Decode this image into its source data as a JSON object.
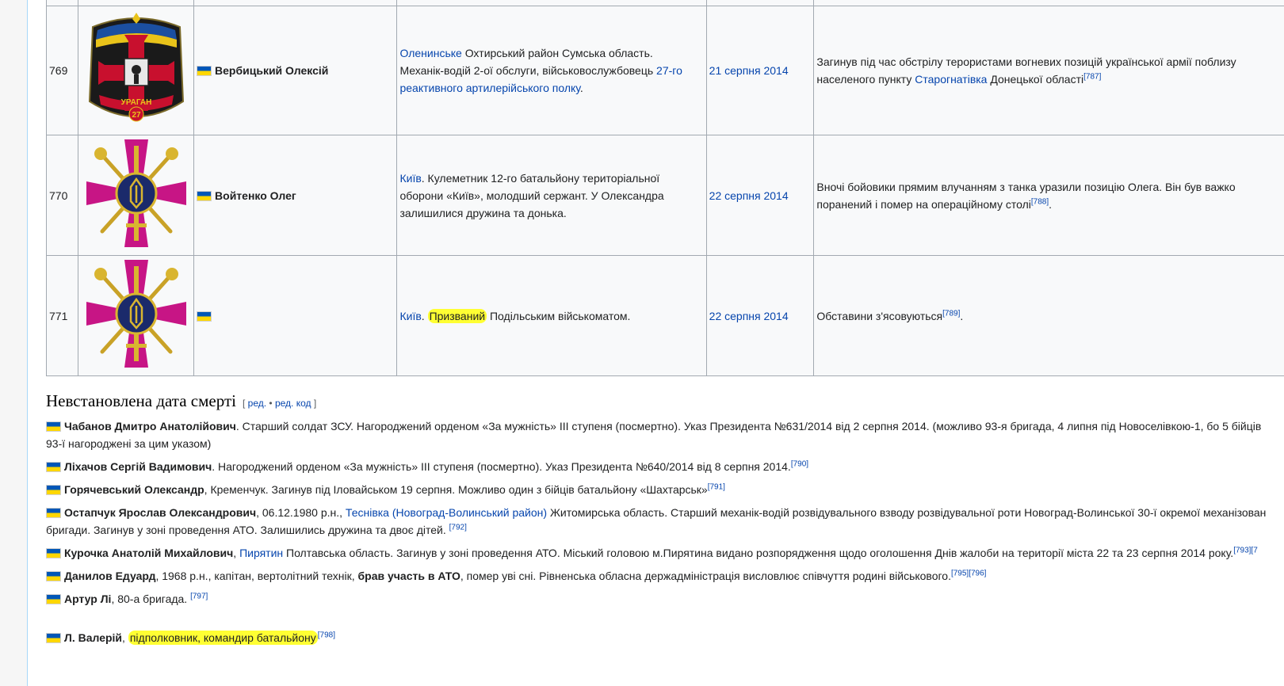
{
  "table": {
    "rows": [
      {
        "num": "769",
        "emblem": "uragan-27-brigade-emblem",
        "emblem_text": "УРАГАН",
        "emblem_number": "27",
        "name": "Вербицький Олексій",
        "place_link": "Оленинське",
        "place_text1": " Охтирський район Сумська область.",
        "place_text2": "Механік-водій 2-ої обслуги, військовослужбовець ",
        "place_link2a": "27-го",
        "place_link2b": "реактивного артилерійського полку",
        "place_text3": ".",
        "date": "21 серпня 2014",
        "circ_text1": "Загинув під час обстрілу терористами вогневих позицій української армії поблизу",
        "circ_text2": "населеного пункту ",
        "circ_link": "Старогнатівка",
        "circ_text3": " Донецької області",
        "ref": "[787]"
      },
      {
        "num": "770",
        "emblem": "armed-forces-cross-emblem",
        "name": "Войтенко Олег",
        "place_link": "Київ",
        "place_text1": ". Кулеметник 12-го батальйону територіальної",
        "place_text2": "оборони «Київ», молодший сержант. У Олександра",
        "place_text3": "залишилися дружина та донька.",
        "date": "22 серпня 2014",
        "circ_text1": "Вночі бойовики прямим влучанням з танка уразили позицію Олега. Він був важко",
        "circ_text2": "поранений і помер на операційному столі",
        "ref": "[788]",
        "circ_end": "."
      },
      {
        "num": "771",
        "emblem": "armed-forces-cross-emblem",
        "name": "",
        "place_link": "Київ",
        "place_text1": ". ",
        "place_mark": "Призваний",
        "place_text2": " Подільським військоматом.",
        "date": "22 серпня 2014",
        "circ_text1": "Обставини з'ясовуються",
        "ref": "[789]",
        "circ_end": "."
      }
    ]
  },
  "section": {
    "title": "Невстановлена дата смерті",
    "edit_open": "[ ",
    "edit": "ред.",
    "sep": " • ",
    "edit_code": "ред. код",
    "edit_close": " ]"
  },
  "entries": [
    {
      "name": "Чабанов Дмитро Анатолійович",
      "text1": ". Старший солдат ЗСУ. Нагороджений орденом «За мужність» ІІІ ступеня (посмертно). Указ Президента №631/2014 від 2 серпня 2014. (можливо 93-я бригада, 4 липня під Новоселівкою-1, бо 5 бійців",
      "text2": "93-ї нагороджені за цим указом)"
    },
    {
      "name": "Ліхачов Сергій Вадимович",
      "text1": ". Нагороджений орденом «За мужність» ІІІ ступеня (посмертно). Указ Президента №640/2014 від 8 серпня 2014.",
      "ref": "[790]"
    },
    {
      "name": "Горячевський Олександр",
      "text1": ", Кременчук. Загинув під Іловайськом 19 серпня. Можливо один з бійців батальйону «Шахтарськ»",
      "ref": "[791]"
    },
    {
      "name": "Остапчук Ярослав Олександрович",
      "text1": ", 06.12.1980 р.н., ",
      "link": "Теснівка (Новоград-Волинський район)",
      "text2": " Житомирська область. Старший механік-водій розвідувального взводу розвідувальної роти Новоград-Волинської 30-ї окремої механізован",
      "text3": "бригади. Загинув у зоні проведення АТО. Залишились дружина та двоє дітей. ",
      "ref": "[792]"
    },
    {
      "name": "Курочка Анатолій Михайлович",
      "text1": ", ",
      "link": "Пирятин",
      "text2": " Полтавська область. Загинув у зоні проведення АТО. Міський головою м.Пирятина видано розпорядження щодо оголошення Днів жалоби на території міста 22 та 23 серпня 2014 року.",
      "ref": "[793][7"
    },
    {
      "name": "Данилов Едуард",
      "text1": ", 1968 р.н., капітан, вертолітний технік, ",
      "bold": "брав участь в АТО",
      "text2": ", помер уві сні. Рівненська обласна держадміністрація висловлює співчуття родині військового.",
      "ref": "[795][796]"
    },
    {
      "name": "Артур Лі",
      "text1": ", 80-а бригада. ",
      "ref": "[797]"
    },
    {
      "name": "Л. Валерій",
      "text1": ", ",
      "mark": "підполковник, командир батальйону",
      "ref": "[798]"
    }
  ],
  "colors": {
    "link": "#0645ad",
    "highlight": "#ffff33",
    "table_border": "#a2a9b1",
    "flag_blue": "#0057b7",
    "flag_yellow": "#ffd700",
    "cross_magenta": "#c71585"
  }
}
